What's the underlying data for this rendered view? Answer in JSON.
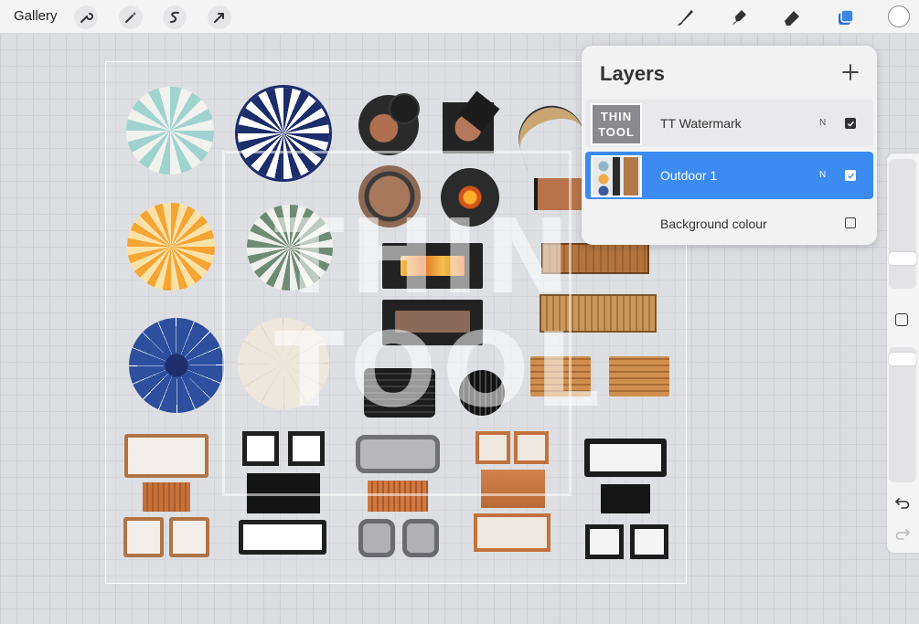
{
  "toolbar": {
    "gallery_label": "Gallery",
    "left_tools": [
      "wrench-icon",
      "magic-wand-icon",
      "selection-icon",
      "transform-arrow-icon"
    ],
    "right_tools": [
      "brush-icon",
      "smudge-icon",
      "eraser-icon",
      "layers-icon"
    ],
    "accent_color": "#3a86e0"
  },
  "canvas": {
    "watermark_line1": "THIN",
    "watermark_line2": "TOOL"
  },
  "layers_panel": {
    "title": "Layers",
    "layers": [
      {
        "name": "TT Watermark",
        "blend": "N",
        "visible": true,
        "selected": false,
        "thumb_line1": "THIN",
        "thumb_line2": "TOOL"
      },
      {
        "name": "Outdoor 1",
        "blend": "N",
        "visible": true,
        "selected": true
      },
      {
        "name": "Background colour",
        "visible": false,
        "selected": false
      }
    ],
    "selected_color": "#3b8bf0"
  },
  "sidebar": {
    "tools": [
      "brush-size-slider",
      "modify-square-button",
      "opacity-slider",
      "undo-icon",
      "redo-icon"
    ]
  }
}
